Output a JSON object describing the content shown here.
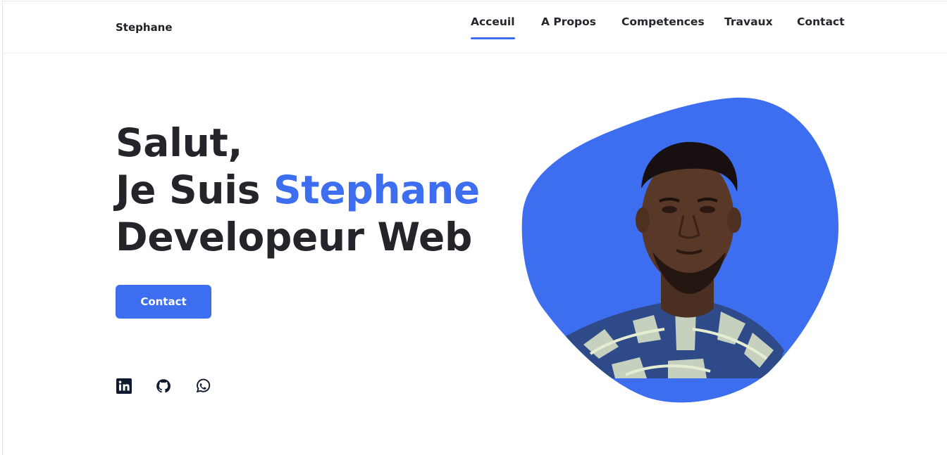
{
  "brand": {
    "name": "Stephane"
  },
  "nav": {
    "items": [
      {
        "label": "Acceuil",
        "active": true
      },
      {
        "label": "A Propos",
        "active": false
      },
      {
        "label": "Competences",
        "active": false
      },
      {
        "label": "Travaux",
        "active": false
      },
      {
        "label": "Contact",
        "active": false
      }
    ]
  },
  "hero": {
    "greeting": "Salut,",
    "intro_prefix": "Je Suis ",
    "name": "Stephane",
    "role": "Developeur Web",
    "cta_label": "Contact"
  },
  "socials": [
    {
      "icon": "linkedin-icon"
    },
    {
      "icon": "github-icon"
    },
    {
      "icon": "whatsapp-icon"
    }
  ],
  "colors": {
    "accent": "#3d6ef0",
    "text": "#23252a",
    "background": "#ffffff"
  }
}
